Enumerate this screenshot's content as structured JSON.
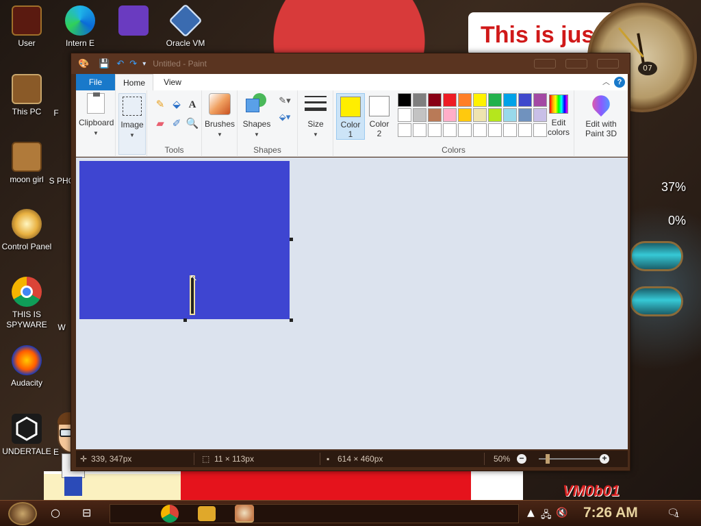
{
  "desktop": {
    "icons": [
      {
        "label": "User"
      },
      {
        "label": "This PC"
      },
      {
        "label": "moon girl"
      },
      {
        "label": "Control Panel"
      },
      {
        "label": "THIS IS SPYWARE"
      },
      {
        "label": "Audacity"
      },
      {
        "label": "UNDERTALE"
      },
      {
        "label": "Intern E"
      },
      {
        "label": "Oracle VM"
      }
    ],
    "partial_labels": {
      "f": "F",
      "s": "S PHC",
      "w": "W",
      "e": "E"
    },
    "banner_text": "This is jus",
    "clock_date": "07",
    "gauges": {
      "cpu": "37%",
      "other": "0%"
    },
    "watermark": "VM0b01"
  },
  "paint": {
    "title": "Untitled - Paint",
    "tabs": {
      "file": "File",
      "home": "Home",
      "view": "View"
    },
    "help": "?",
    "ribbon": {
      "clipboard": "Clipboard",
      "image": "Image",
      "tools_group": "Tools",
      "brushes": "Brushes",
      "shapes_btn": "Shapes",
      "shapes_group": "Shapes",
      "size": "Size",
      "color1": "Color\n1",
      "color1_line1": "Color",
      "color1_line2": "1",
      "color2_line1": "Color",
      "color2_line2": "2",
      "edit_colors_line1": "Edit",
      "edit_colors_line2": "colors",
      "colors_group": "Colors",
      "paint3d_line1": "Edit with",
      "paint3d_line2": "Paint 3D",
      "text_tool": "A"
    },
    "color1_value": "#ffee00",
    "color2_value": "#ffffff",
    "palette_row1": [
      "#000000",
      "#7f7f7f",
      "#880015",
      "#ed1c24",
      "#ff7f27",
      "#fff200",
      "#22b14c",
      "#00a2e8",
      "#3f48cc",
      "#a349a4"
    ],
    "palette_row2": [
      "#ffffff",
      "#c3c3c3",
      "#b97a57",
      "#ffaec9",
      "#ffc90e",
      "#efe4b0",
      "#b5e61d",
      "#99d9ea",
      "#7092be",
      "#c8bfe7"
    ],
    "palette_row3": [
      "#ffffff",
      "#ffffff",
      "#ffffff",
      "#ffffff",
      "#ffffff",
      "#ffffff",
      "#ffffff",
      "#ffffff",
      "#ffffff",
      "#ffffff"
    ],
    "canvas_color": "#3e45d1",
    "status": {
      "cursor_pos": "339, 347px",
      "selection_size": "11 × 113px",
      "image_size": "614 × 460px",
      "zoom": "50%",
      "zoom_out": "−",
      "zoom_in": "+"
    }
  },
  "taskbar": {
    "time": "7:26 AM",
    "notification_count": "1"
  }
}
